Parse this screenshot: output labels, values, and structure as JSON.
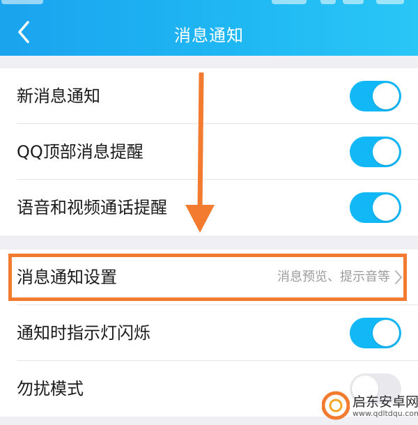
{
  "header": {
    "title": "消息通知",
    "back_icon": "chevron-left-icon",
    "background_colors": [
      "#1aa3ee",
      "#2ac6f6"
    ]
  },
  "settings": {
    "new_message": {
      "label": "新消息通知",
      "enabled": true
    },
    "qq_top": {
      "label": "QQ顶部消息提醒",
      "enabled": true
    },
    "voice_video": {
      "label": "语音和视频通话提醒",
      "enabled": true
    },
    "notification_settings": {
      "label": "消息通知设置",
      "hint": "消息预览、提示音等",
      "chevron_icon": "chevron-right-icon"
    },
    "indicator_light": {
      "label": "通知时指示灯闪烁",
      "enabled": true
    },
    "dnd": {
      "label": "勿扰模式",
      "enabled": false
    }
  },
  "annotations": {
    "arrow_color": "#f37b30",
    "highlight_color": "#f37b30"
  },
  "watermark": {
    "title": "启东安卓网",
    "url": "www.qdltdqu.com"
  },
  "colors": {
    "switch_on": "#12b7f5",
    "switch_off": "#e8e8ed"
  }
}
